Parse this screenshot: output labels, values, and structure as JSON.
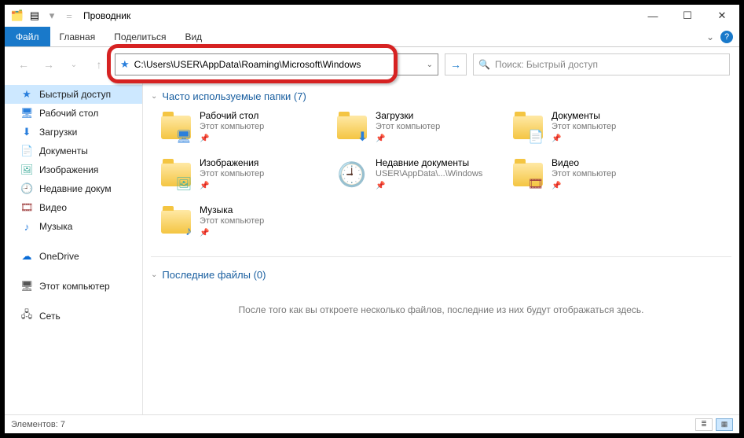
{
  "window": {
    "title": "Проводник"
  },
  "ribbon": {
    "file": "Файл",
    "tabs": [
      "Главная",
      "Поделиться",
      "Вид"
    ]
  },
  "address": {
    "path": "C:\\Users\\USER\\AppData\\Roaming\\Microsoft\\Windows"
  },
  "search": {
    "placeholder": "Поиск: Быстрый доступ"
  },
  "sidebar": {
    "quick": "Быстрый доступ",
    "desktop": "Рабочий стол",
    "downloads": "Загрузки",
    "documents": "Документы",
    "images": "Изображения",
    "recent": "Недавние докум",
    "video": "Видео",
    "music": "Музыка",
    "onedrive": "OneDrive",
    "thispc": "Этот компьютер",
    "network": "Сеть"
  },
  "groups": {
    "freq_title": "Часто используемые папки (7)",
    "recent_title": "Последние файлы (0)",
    "recent_empty": "После того как вы откроете несколько файлов, последние из них будут отображаться здесь."
  },
  "tiles": [
    {
      "name": "Рабочий стол",
      "sub": "Этот компьютер",
      "kind": "desktop"
    },
    {
      "name": "Загрузки",
      "sub": "Этот компьютер",
      "kind": "downloads"
    },
    {
      "name": "Документы",
      "sub": "Этот компьютер",
      "kind": "documents"
    },
    {
      "name": "Изображения",
      "sub": "Этот компьютер",
      "kind": "images"
    },
    {
      "name": "Недавние документы",
      "sub": "USER\\AppData\\...\\Windows",
      "kind": "recent"
    },
    {
      "name": "Видео",
      "sub": "Этот компьютер",
      "kind": "video"
    },
    {
      "name": "Музыка",
      "sub": "Этот компьютер",
      "kind": "music"
    }
  ],
  "status": {
    "count": "Элементов: 7"
  }
}
